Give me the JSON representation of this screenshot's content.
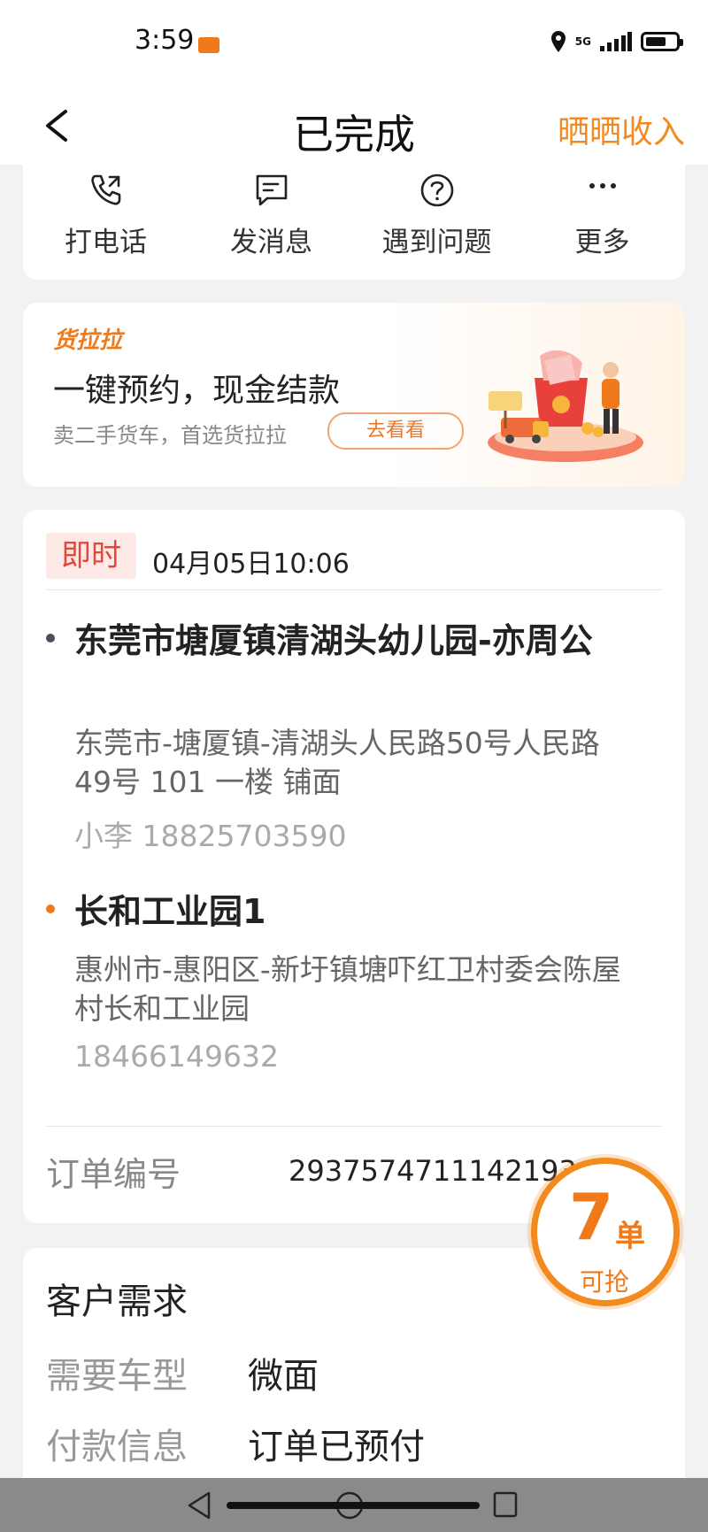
{
  "status_bar": {
    "time": "3:59",
    "network": "5G"
  },
  "header": {
    "title": "已完成",
    "right_action": "晒晒收入"
  },
  "actions": [
    {
      "label": "打电话",
      "icon": "phone-icon"
    },
    {
      "label": "发消息",
      "icon": "message-icon"
    },
    {
      "label": "遇到问题",
      "icon": "question-icon"
    },
    {
      "label": "更多",
      "icon": "more-icon"
    }
  ],
  "promo": {
    "logo": "货拉拉",
    "title": "一键预约，现金结款",
    "subtitle": "卖二手货车，首选货拉拉",
    "button": "去看看"
  },
  "order": {
    "tag": "即时",
    "time": "04月05日10:06",
    "stops": [
      {
        "name": "东莞市塘厦镇清湖头幼儿园-亦周公",
        "address": "东莞市-塘厦镇-清湖头人民路50号人民路49号  101 一楼 铺面",
        "contact": "小李 18825703590",
        "dot_color": "#4a4f5c"
      },
      {
        "name": "长和工业园1",
        "address": "惠州市-惠阳区-新圩镇塘吓红卫村委会陈屋村长和工业园",
        "contact": "18466149632",
        "dot_color": "#f07a1a"
      }
    ],
    "number_label": "订单编号",
    "number": "2937574711142193"
  },
  "float_badge": {
    "count": "7",
    "unit": "单",
    "subtitle": "可抢"
  },
  "demand": {
    "title": "客户需求",
    "rows": [
      {
        "key": "需要车型",
        "value": "微面"
      },
      {
        "key": "付款信息",
        "value": "订单已预付"
      }
    ]
  },
  "colors": {
    "accent": "#f07a1a",
    "instant_tag": "#e5473c"
  }
}
